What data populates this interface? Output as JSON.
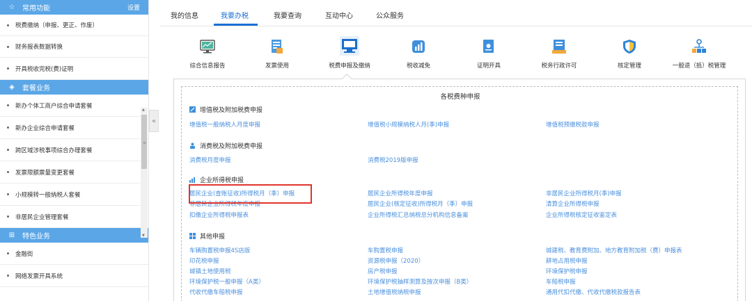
{
  "sidebar": {
    "common": {
      "title": "常用功能",
      "settings": "设置",
      "items": [
        "税费缴纳（申报、更正、作废）",
        "财务报表数据转换",
        "开具税收完税(费)证明"
      ]
    },
    "package": {
      "title": "套餐业务",
      "items": [
        "新办个体工商户综合申请套餐",
        "新办企业综合申请套餐",
        "跨区域涉税事项综合办理套餐",
        "发票限额票量变更套餐",
        "小规模转一般纳税人套餐",
        "非居民企业管理套餐"
      ]
    },
    "special": {
      "title": "特色业务",
      "items": [
        "金融街",
        "网络发票开具系统"
      ]
    }
  },
  "tabs": [
    "我的信息",
    "我要办税",
    "我要查询",
    "互动中心",
    "公众服务"
  ],
  "tools": [
    {
      "label": "综合信息报告",
      "icon": "monitor-chart-icon"
    },
    {
      "label": "发票使用",
      "icon": "invoice-doc-icon"
    },
    {
      "label": "税费申报及缴纳",
      "icon": "screen-icon"
    },
    {
      "label": "税收减免",
      "icon": "bar-chart-icon"
    },
    {
      "label": "证明开具",
      "icon": "certificate-icon"
    },
    {
      "label": "税务行政许可",
      "icon": "license-icon"
    },
    {
      "label": "核定管理",
      "icon": "shield-icon"
    },
    {
      "label": "一般退（抵）税管理",
      "icon": "org-chart-icon"
    }
  ],
  "panel": {
    "title": "各税费种申报",
    "categories": [
      {
        "title": "增值税及附加税费申报",
        "links": [
          "增值税一般纳税人月度申报",
          "增值税小规模纳税人月(季)申报",
          "增值税预缴税款申报"
        ]
      },
      {
        "title": "消费税及附加税费申报",
        "links": [
          "消费税月度申报",
          "消费税2019版申报"
        ]
      },
      {
        "title": "企业所得税申报",
        "links": [
          "居民企业(查账征收)所得税月（季）申报",
          "居民企业所得税年度申报",
          "非居民企业所得税月(季)申报",
          "非居民企业所得税年度申报",
          "居民企业(核定征收)所得税月（季）申报",
          "清算企业所得税申报",
          "扣缴企业所得税申报表",
          "企业所得税汇总纳税总分机构信息备案",
          "企业所得税核定征收鉴定表"
        ]
      },
      {
        "title": "其他申报",
        "links": [
          "车辆购置税申报4S店版",
          "车购置税申报",
          "城建税、教育费附加、地方教育附加税（费）申报表",
          "印花税申报",
          "资源税申报（2020）",
          "耕地占用税申报",
          "城镇土地使用税",
          "房产税申报",
          "环境保护税申报",
          "环境保护税一般申报（A类）",
          "环境保护税抽样测算及按次申报（B类）",
          "车船税申报",
          "代收代缴车船税申报",
          "土地增值税纳税申报",
          "通用代扣代缴、代收代缴税款报告表"
        ]
      }
    ]
  },
  "colors": {
    "accent": "#1a6fd6",
    "link": "#4a8fdc",
    "sidebar_head": "#5aa6e6",
    "highlight": "#e0352b"
  }
}
